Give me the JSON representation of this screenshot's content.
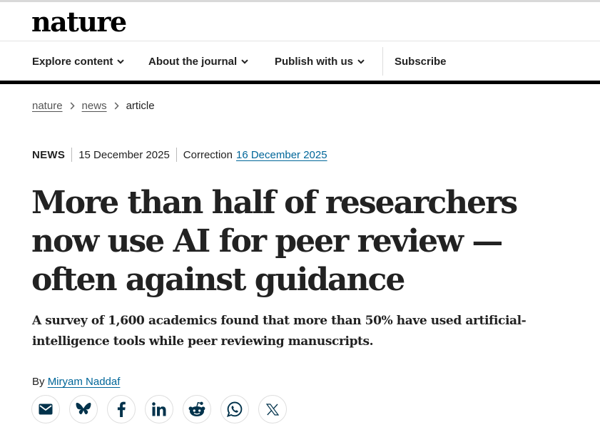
{
  "site": {
    "logo": "nature"
  },
  "nav": {
    "items": [
      {
        "label": "Explore content",
        "has_dropdown": true
      },
      {
        "label": "About the journal",
        "has_dropdown": true
      },
      {
        "label": "Publish with us",
        "has_dropdown": true
      },
      {
        "label": "Subscribe",
        "has_dropdown": false
      }
    ]
  },
  "breadcrumb": {
    "items": [
      "nature",
      "news",
      "article"
    ]
  },
  "article": {
    "type": "NEWS",
    "date": "15 December 2025",
    "correction_label": "Correction",
    "correction_date": "16 December 2025",
    "title": "More than half of researchers now use AI for peer review — often against guidance",
    "standfirst": "A survey of 1,600 academics found that more than 50% have used artificial-intelligence tools while peer reviewing manuscripts.",
    "byline_prefix": "By",
    "author": "Miryam Naddaf"
  },
  "share": {
    "icons": [
      "email-icon",
      "bluesky-icon",
      "facebook-icon",
      "linkedin-icon",
      "reddit-icon",
      "whatsapp-icon",
      "x-icon"
    ],
    "icon_color": "#01324b"
  },
  "colors": {
    "link": "#006699",
    "text": "#222222",
    "rule": "#000000"
  }
}
